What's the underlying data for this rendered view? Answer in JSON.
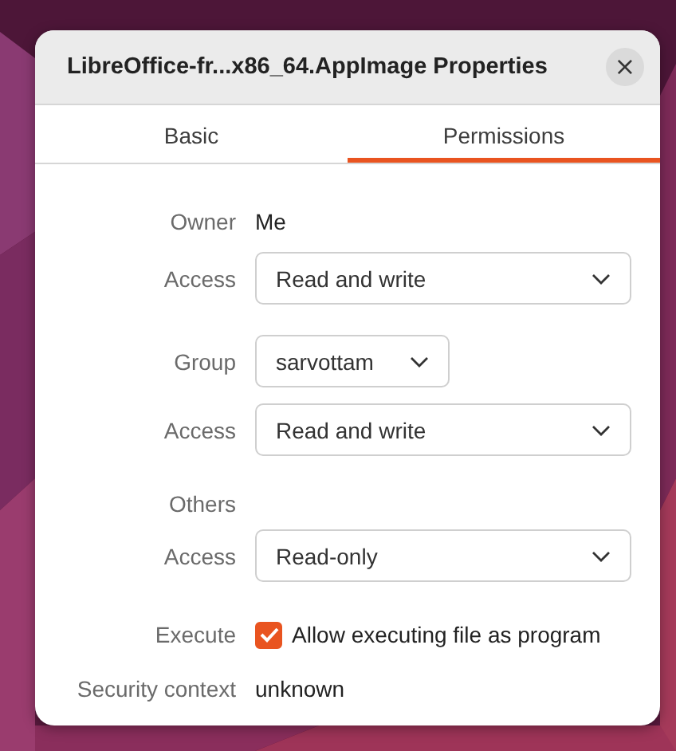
{
  "window": {
    "title": "LibreOffice-fr...x86_64.AppImage Properties",
    "close": "×"
  },
  "tabs": [
    {
      "label": "Basic",
      "selected": false
    },
    {
      "label": "Permissions",
      "selected": true
    }
  ],
  "rows": [
    {
      "kind": "text",
      "label": "Owner",
      "value": "Me"
    },
    {
      "kind": "dropdown",
      "label": "Access",
      "value": "Read and write",
      "wide": true
    },
    {
      "kind": "dropdown",
      "label": "Group",
      "value": "sarvottam",
      "wide": false
    },
    {
      "kind": "dropdown",
      "label": "Access",
      "value": "Read and write",
      "wide": true
    },
    {
      "kind": "heading",
      "label": "Others"
    },
    {
      "kind": "dropdown",
      "label": "Access",
      "value": "Read-only",
      "wide": true
    },
    {
      "kind": "checkbox",
      "label": "Execute",
      "value": "Allow executing file as program",
      "checked": true
    },
    {
      "kind": "text",
      "label": "Security context",
      "value": "unknown"
    }
  ]
}
